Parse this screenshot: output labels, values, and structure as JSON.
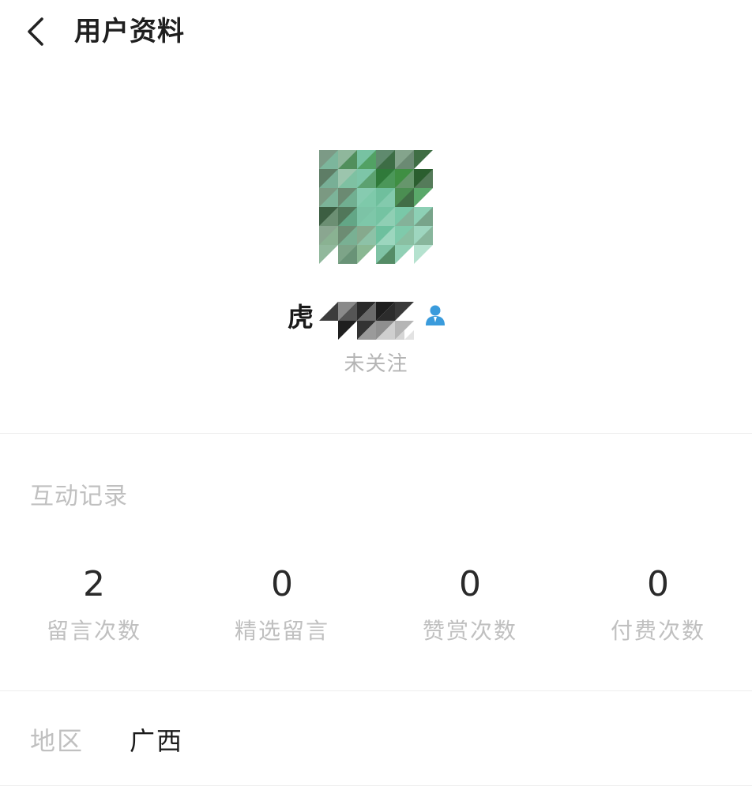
{
  "header": {
    "title": "用户资料",
    "back_icon": "chevron-left-icon"
  },
  "profile": {
    "name_visible": "虎",
    "verified_icon": "user-badge-icon",
    "accent_color": "#3a9bdc",
    "follow_status": "未关注"
  },
  "interaction": {
    "title": "互动记录",
    "stats": [
      {
        "value": "2",
        "label": "留言次数"
      },
      {
        "value": "0",
        "label": "精选留言"
      },
      {
        "value": "0",
        "label": "赞赏次数"
      },
      {
        "value": "0",
        "label": "付费次数"
      }
    ]
  },
  "region": {
    "label": "地区",
    "value": "广西"
  }
}
